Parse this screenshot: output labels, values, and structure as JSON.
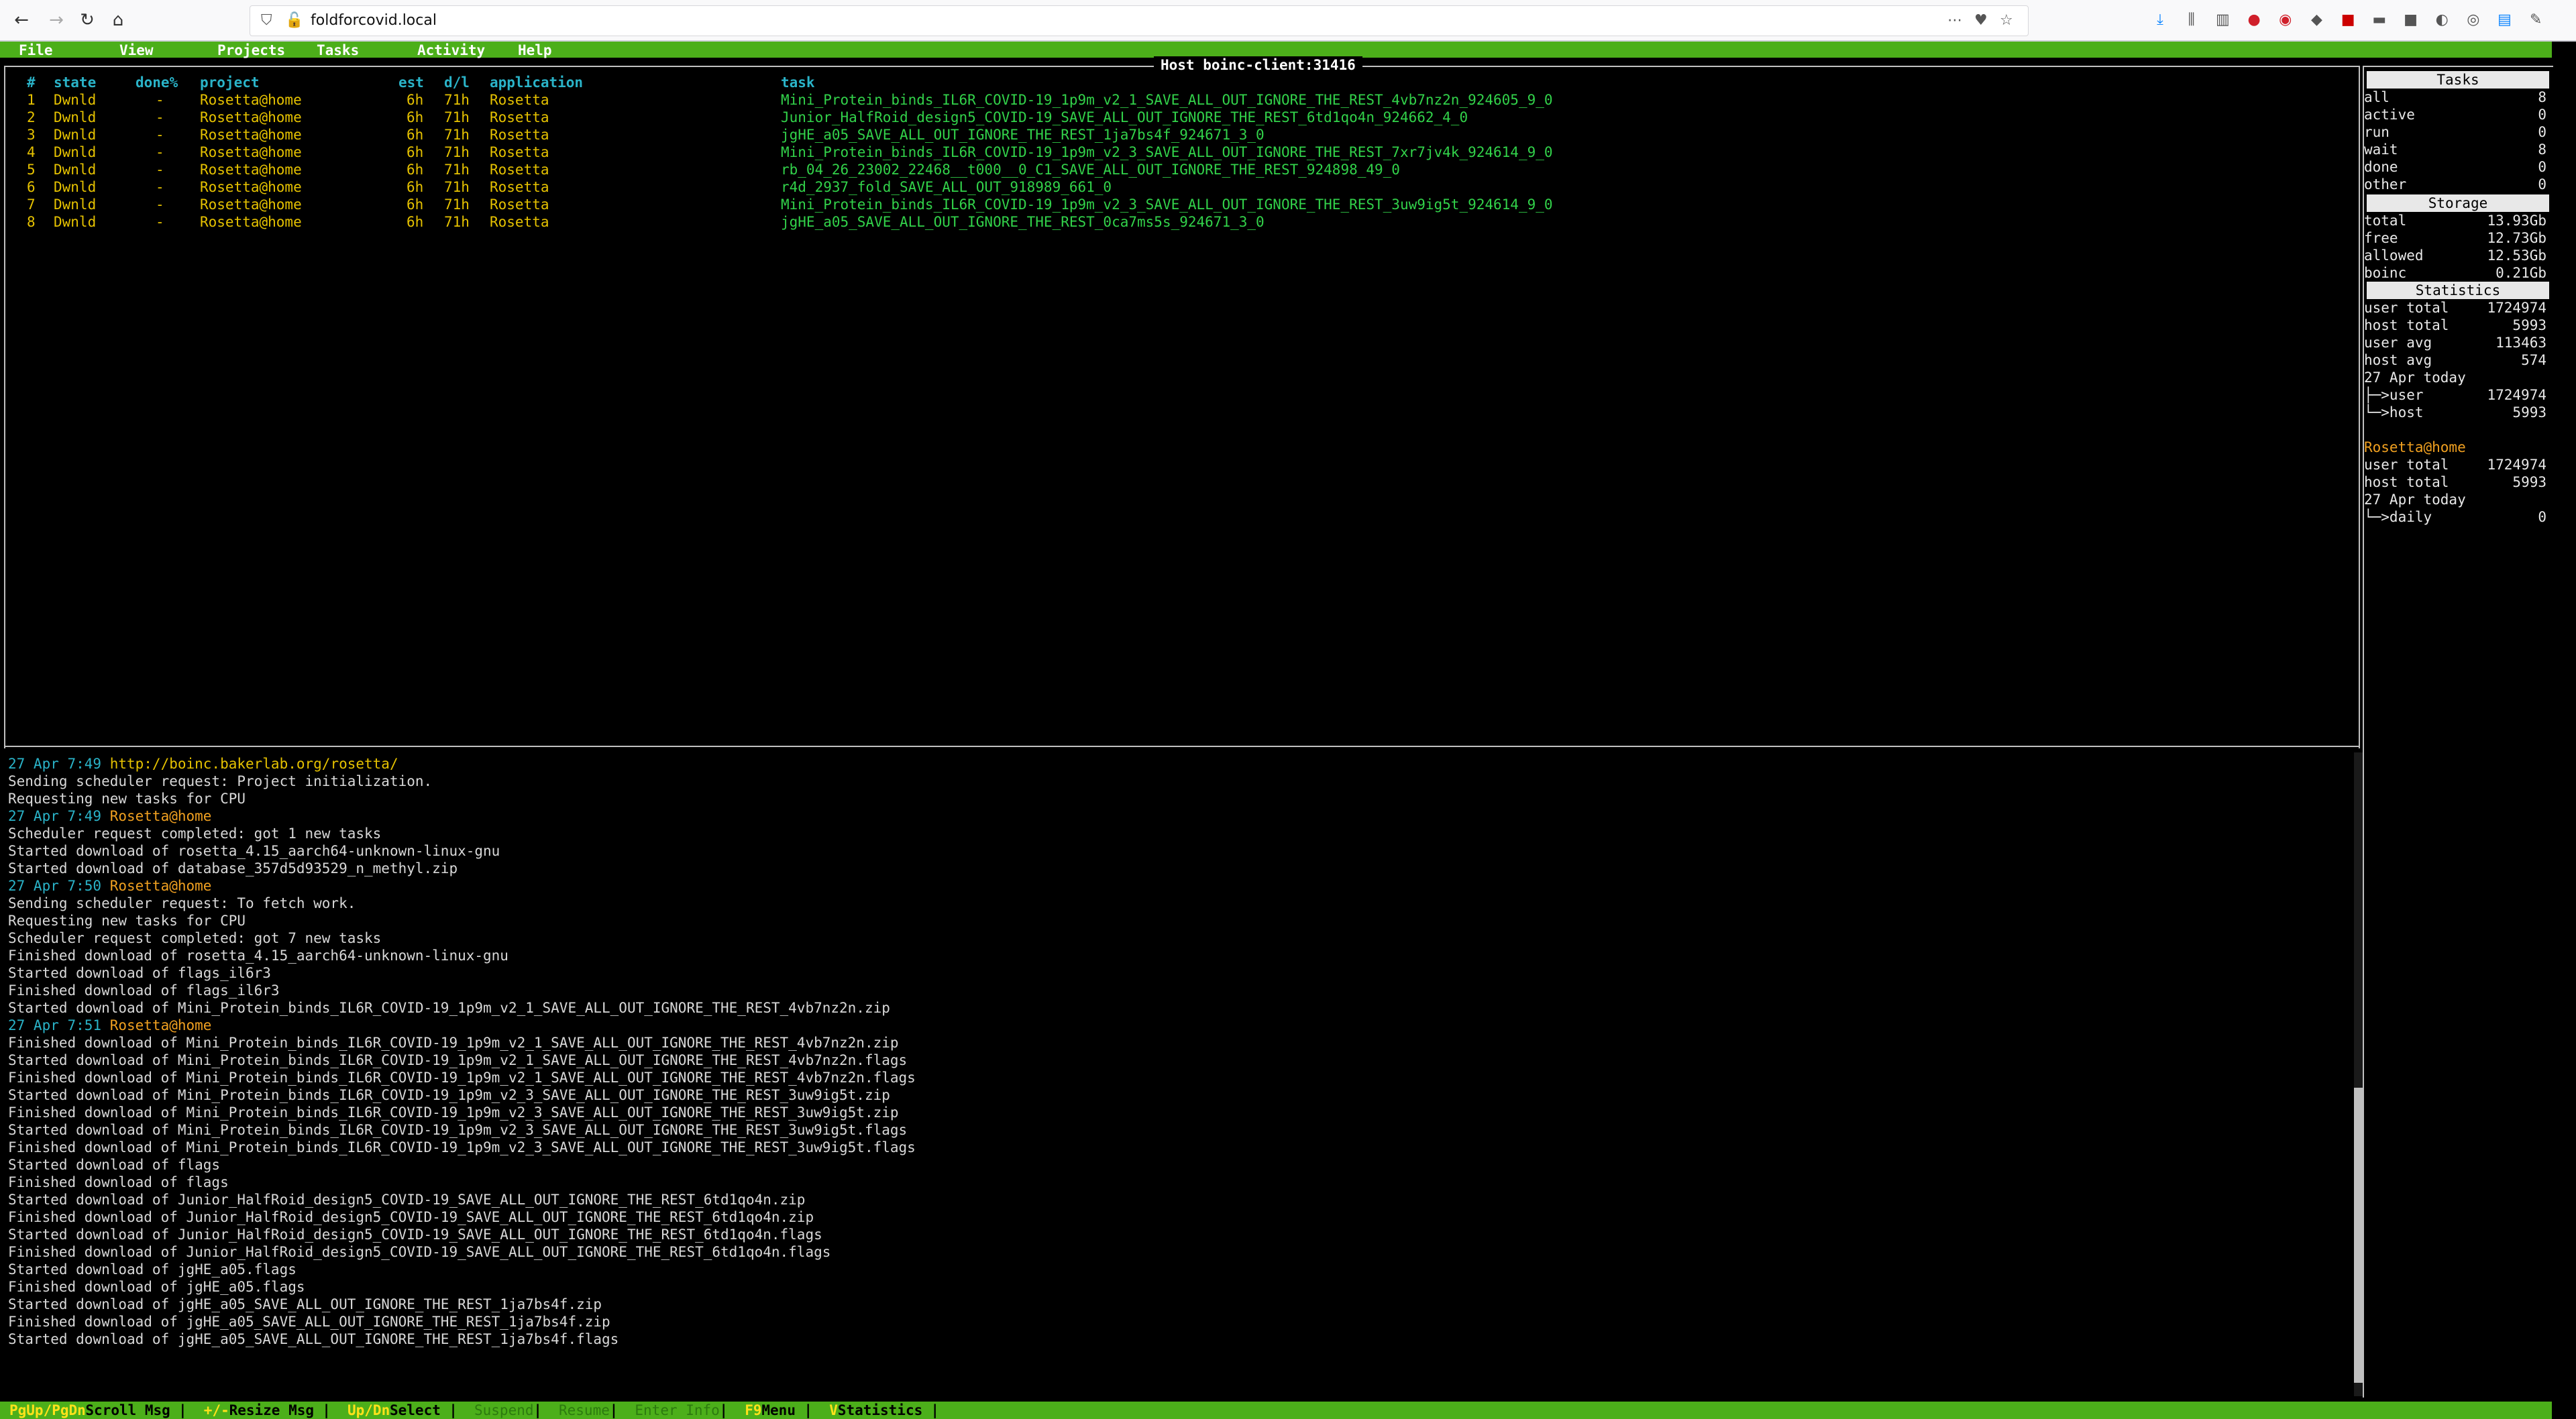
{
  "browser": {
    "url": "foldforcovid.local"
  },
  "menu": [
    "File",
    "View",
    "Projects",
    "Tasks",
    "Activity",
    "Help"
  ],
  "host_title": "Host boinc-client:31416",
  "tasks_table": {
    "columns": [
      "#",
      "state",
      "done%",
      "project",
      "est",
      "d/l",
      "application",
      "task"
    ],
    "rows": [
      {
        "num": "1",
        "state": "Dwnld",
        "done": "-",
        "project": "Rosetta@home",
        "est": "6h",
        "dl": "71h",
        "app": "Rosetta",
        "task": "Mini_Protein_binds_IL6R_COVID-19_1p9m_v2_1_SAVE_ALL_OUT_IGNORE_THE_REST_4vb7nz2n_924605_9_0"
      },
      {
        "num": "2",
        "state": "Dwnld",
        "done": "-",
        "project": "Rosetta@home",
        "est": "6h",
        "dl": "71h",
        "app": "Rosetta",
        "task": "Junior_HalfRoid_design5_COVID-19_SAVE_ALL_OUT_IGNORE_THE_REST_6td1qo4n_924662_4_0"
      },
      {
        "num": "3",
        "state": "Dwnld",
        "done": "-",
        "project": "Rosetta@home",
        "est": "6h",
        "dl": "71h",
        "app": "Rosetta",
        "task": "jgHE_a05_SAVE_ALL_OUT_IGNORE_THE_REST_1ja7bs4f_924671_3_0"
      },
      {
        "num": "4",
        "state": "Dwnld",
        "done": "-",
        "project": "Rosetta@home",
        "est": "6h",
        "dl": "71h",
        "app": "Rosetta",
        "task": "Mini_Protein_binds_IL6R_COVID-19_1p9m_v2_3_SAVE_ALL_OUT_IGNORE_THE_REST_7xr7jv4k_924614_9_0"
      },
      {
        "num": "5",
        "state": "Dwnld",
        "done": "-",
        "project": "Rosetta@home",
        "est": "6h",
        "dl": "71h",
        "app": "Rosetta",
        "task": "rb_04_26_23002_22468__t000__0_C1_SAVE_ALL_OUT_IGNORE_THE_REST_924898_49_0"
      },
      {
        "num": "6",
        "state": "Dwnld",
        "done": "-",
        "project": "Rosetta@home",
        "est": "6h",
        "dl": "71h",
        "app": "Rosetta",
        "task": "r4d_2937_fold_SAVE_ALL_OUT_918989_661_0"
      },
      {
        "num": "7",
        "state": "Dwnld",
        "done": "-",
        "project": "Rosetta@home",
        "est": "6h",
        "dl": "71h",
        "app": "Rosetta",
        "task": "Mini_Protein_binds_IL6R_COVID-19_1p9m_v2_3_SAVE_ALL_OUT_IGNORE_THE_REST_3uw9ig5t_924614_9_0"
      },
      {
        "num": "8",
        "state": "Dwnld",
        "done": "-",
        "project": "Rosetta@home",
        "est": "6h",
        "dl": "71h",
        "app": "Rosetta",
        "task": "jgHE_a05_SAVE_ALL_OUT_IGNORE_THE_REST_0ca7ms5s_924671_3_0"
      }
    ]
  },
  "log": [
    {
      "type": "ts",
      "ts": "27 Apr 7:49",
      "src": "http://boinc.bakerlab.org/rosetta/",
      "srctype": "url"
    },
    {
      "type": "msg",
      "text": "Sending scheduler request: Project initialization."
    },
    {
      "type": "msg",
      "text": "Requesting new tasks for CPU"
    },
    {
      "type": "ts",
      "ts": "27 Apr 7:49",
      "src": "Rosetta@home",
      "srctype": "proj"
    },
    {
      "type": "msg",
      "text": "Scheduler request completed: got 1 new tasks"
    },
    {
      "type": "msg",
      "text": "Started download of rosetta_4.15_aarch64-unknown-linux-gnu"
    },
    {
      "type": "msg",
      "text": "Started download of database_357d5d93529_n_methyl.zip"
    },
    {
      "type": "ts",
      "ts": "27 Apr 7:50",
      "src": "Rosetta@home",
      "srctype": "proj"
    },
    {
      "type": "msg",
      "text": "Sending scheduler request: To fetch work."
    },
    {
      "type": "msg",
      "text": "Requesting new tasks for CPU"
    },
    {
      "type": "msg",
      "text": "Scheduler request completed: got 7 new tasks"
    },
    {
      "type": "msg",
      "text": "Finished download of rosetta_4.15_aarch64-unknown-linux-gnu"
    },
    {
      "type": "msg",
      "text": "Started download of flags_il6r3"
    },
    {
      "type": "msg",
      "text": "Finished download of flags_il6r3"
    },
    {
      "type": "msg",
      "text": "Started download of Mini_Protein_binds_IL6R_COVID-19_1p9m_v2_1_SAVE_ALL_OUT_IGNORE_THE_REST_4vb7nz2n.zip"
    },
    {
      "type": "ts",
      "ts": "27 Apr 7:51",
      "src": "Rosetta@home",
      "srctype": "proj"
    },
    {
      "type": "msg",
      "text": "Finished download of Mini_Protein_binds_IL6R_COVID-19_1p9m_v2_1_SAVE_ALL_OUT_IGNORE_THE_REST_4vb7nz2n.zip"
    },
    {
      "type": "msg",
      "text": "Started download of Mini_Protein_binds_IL6R_COVID-19_1p9m_v2_1_SAVE_ALL_OUT_IGNORE_THE_REST_4vb7nz2n.flags"
    },
    {
      "type": "msg",
      "text": "Finished download of Mini_Protein_binds_IL6R_COVID-19_1p9m_v2_1_SAVE_ALL_OUT_IGNORE_THE_REST_4vb7nz2n.flags"
    },
    {
      "type": "msg",
      "text": "Started download of Mini_Protein_binds_IL6R_COVID-19_1p9m_v2_3_SAVE_ALL_OUT_IGNORE_THE_REST_3uw9ig5t.zip"
    },
    {
      "type": "msg",
      "text": "Finished download of Mini_Protein_binds_IL6R_COVID-19_1p9m_v2_3_SAVE_ALL_OUT_IGNORE_THE_REST_3uw9ig5t.zip"
    },
    {
      "type": "msg",
      "text": "Started download of Mini_Protein_binds_IL6R_COVID-19_1p9m_v2_3_SAVE_ALL_OUT_IGNORE_THE_REST_3uw9ig5t.flags"
    },
    {
      "type": "msg",
      "text": "Finished download of Mini_Protein_binds_IL6R_COVID-19_1p9m_v2_3_SAVE_ALL_OUT_IGNORE_THE_REST_3uw9ig5t.flags"
    },
    {
      "type": "msg",
      "text": "Started download of flags"
    },
    {
      "type": "msg",
      "text": "Finished download of flags"
    },
    {
      "type": "msg",
      "text": "Started download of Junior_HalfRoid_design5_COVID-19_SAVE_ALL_OUT_IGNORE_THE_REST_6td1qo4n.zip"
    },
    {
      "type": "msg",
      "text": "Finished download of Junior_HalfRoid_design5_COVID-19_SAVE_ALL_OUT_IGNORE_THE_REST_6td1qo4n.zip"
    },
    {
      "type": "msg",
      "text": "Started download of Junior_HalfRoid_design5_COVID-19_SAVE_ALL_OUT_IGNORE_THE_REST_6td1qo4n.flags"
    },
    {
      "type": "msg",
      "text": "Finished download of Junior_HalfRoid_design5_COVID-19_SAVE_ALL_OUT_IGNORE_THE_REST_6td1qo4n.flags"
    },
    {
      "type": "msg",
      "text": "Started download of jgHE_a05.flags"
    },
    {
      "type": "msg",
      "text": "Finished download of jgHE_a05.flags"
    },
    {
      "type": "msg",
      "text": "Started download of jgHE_a05_SAVE_ALL_OUT_IGNORE_THE_REST_1ja7bs4f.zip"
    },
    {
      "type": "msg",
      "text": "Finished download of jgHE_a05_SAVE_ALL_OUT_IGNORE_THE_REST_1ja7bs4f.zip"
    },
    {
      "type": "msg",
      "text": "Started download of jgHE_a05_SAVE_ALL_OUT_IGNORE_THE_REST_1ja7bs4f.flags"
    }
  ],
  "panel": {
    "tasks_head": "Tasks",
    "tasks": [
      {
        "k": "all",
        "v": "8"
      },
      {
        "k": "active",
        "v": "0"
      },
      {
        "k": "run",
        "v": "0"
      },
      {
        "k": "wait",
        "v": "8"
      },
      {
        "k": "done",
        "v": "0"
      },
      {
        "k": "other",
        "v": "0"
      }
    ],
    "storage_head": "Storage",
    "storage": [
      {
        "k": "total",
        "v": "13.93Gb"
      },
      {
        "k": "free",
        "v": "12.73Gb"
      },
      {
        "k": "allowed",
        "v": "12.53Gb"
      },
      {
        "k": "boinc",
        "v": "0.21Gb"
      }
    ],
    "stats_head": "Statistics",
    "stats": [
      {
        "k": "user total",
        "v": "1724974"
      },
      {
        "k": "host total",
        "v": "5993"
      },
      {
        "k": "user avg",
        "v": "113463"
      },
      {
        "k": "host avg",
        "v": "574"
      },
      {
        "k": "27 Apr today",
        "v": ""
      },
      {
        "k": " ├─>user",
        "v": "1724974"
      },
      {
        "k": " └─>host",
        "v": "5993"
      }
    ],
    "project_name": "Rosetta@home",
    "project_stats": [
      {
        "k": "user total",
        "v": "1724974"
      },
      {
        "k": "host total",
        "v": "5993"
      },
      {
        "k": "27 Apr today",
        "v": ""
      },
      {
        "k": " └─>daily",
        "v": "0"
      }
    ]
  },
  "statusbar": [
    {
      "key": "PgUp/PgDn",
      "label": " Scroll Msg",
      "enabled": true
    },
    {
      "key": "+/-",
      "label": " Resize Msg",
      "enabled": true
    },
    {
      "key": "Up/Dn",
      "label": " Select",
      "enabled": true
    },
    {
      "key": "Suspend",
      "label": "",
      "enabled": false
    },
    {
      "key": "Resume",
      "label": "",
      "enabled": false
    },
    {
      "key": "Enter Info",
      "label": "",
      "enabled": false
    },
    {
      "key": "F9",
      "label": " Menu",
      "enabled": true
    },
    {
      "key": "V",
      "label": " Statistics",
      "enabled": true
    }
  ]
}
